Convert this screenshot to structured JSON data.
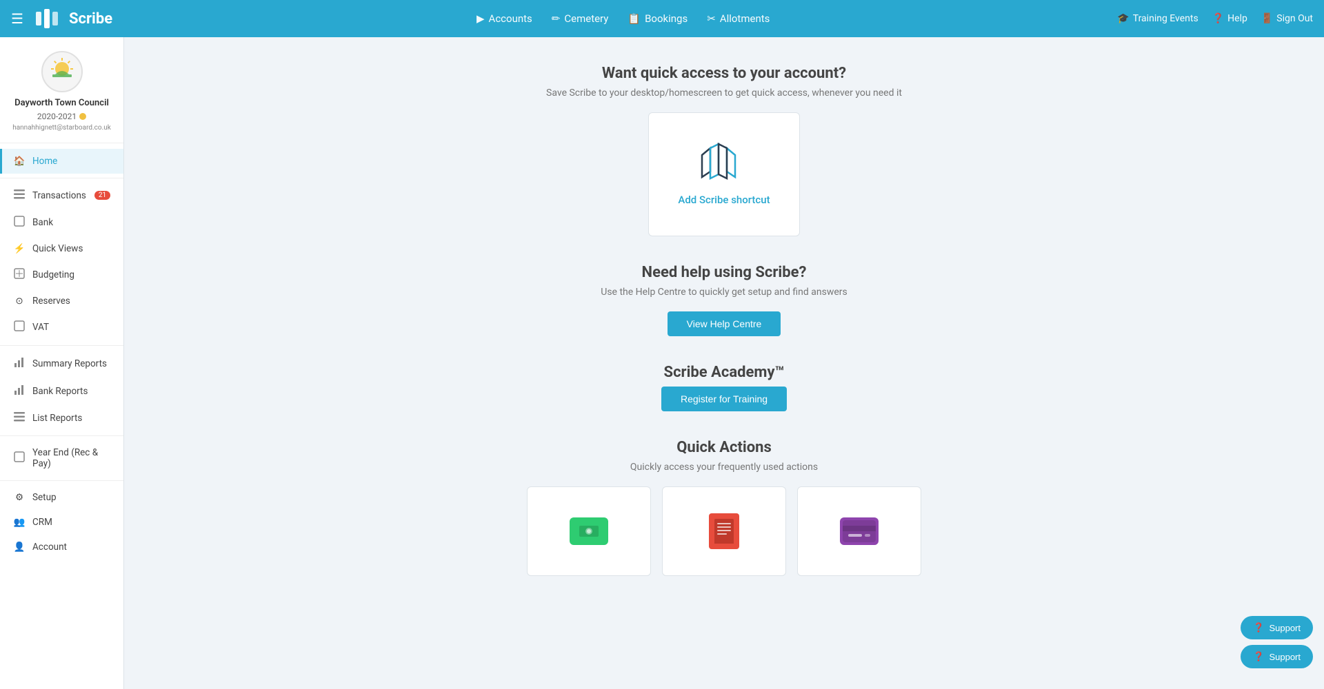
{
  "topnav": {
    "logo_text": "Scribe",
    "hamburger_label": "☰",
    "nav_links": [
      {
        "id": "accounts",
        "label": "Accounts",
        "icon": "▶"
      },
      {
        "id": "cemetery",
        "label": "Cemetery",
        "icon": "✏"
      },
      {
        "id": "bookings",
        "label": "Bookings",
        "icon": "📋"
      },
      {
        "id": "allotments",
        "label": "Allotments",
        "icon": "✂"
      }
    ],
    "right_links": [
      {
        "id": "training-events",
        "label": "Training Events",
        "icon": "🎓"
      },
      {
        "id": "help",
        "label": "Help",
        "icon": "?"
      },
      {
        "id": "sign-out",
        "label": "Sign Out",
        "icon": "→"
      }
    ]
  },
  "sidebar": {
    "org_name": "Dayworth Town Council",
    "year": "2020-2021",
    "email": "hannahhignett@starboard.co.uk",
    "items": [
      {
        "id": "home",
        "label": "Home",
        "icon": "🏠",
        "active": true
      },
      {
        "id": "transactions",
        "label": "Transactions",
        "icon": "≡",
        "badge": "21"
      },
      {
        "id": "bank",
        "label": "Bank",
        "icon": "□"
      },
      {
        "id": "quick-views",
        "label": "Quick Views",
        "icon": "⚡"
      },
      {
        "id": "budgeting",
        "label": "Budgeting",
        "icon": "□"
      },
      {
        "id": "reserves",
        "label": "Reserves",
        "icon": "⊙"
      },
      {
        "id": "vat",
        "label": "VAT",
        "icon": "□"
      },
      {
        "id": "summary-reports",
        "label": "Summary Reports",
        "icon": "📊"
      },
      {
        "id": "bank-reports",
        "label": "Bank Reports",
        "icon": "📊"
      },
      {
        "id": "list-reports",
        "label": "List Reports",
        "icon": "≡"
      },
      {
        "id": "year-end",
        "label": "Year End (Rec & Pay)",
        "icon": "□"
      },
      {
        "id": "setup",
        "label": "Setup",
        "icon": "⚙"
      },
      {
        "id": "crm",
        "label": "CRM",
        "icon": "👥"
      },
      {
        "id": "account",
        "label": "Account",
        "icon": "👤"
      }
    ]
  },
  "shortcut_section": {
    "title": "Want quick access to your account?",
    "subtitle": "Save Scribe to your desktop/homescreen to get quick access, whenever you need it",
    "card_label": "Add Scribe shortcut"
  },
  "help_section": {
    "title": "Need help using Scribe?",
    "subtitle": "Use the Help Centre to quickly get setup and find answers",
    "button_label": "View Help Centre"
  },
  "academy_section": {
    "title": "Scribe Academy™",
    "button_label": "Register for Training"
  },
  "quick_actions": {
    "title": "Quick Actions",
    "subtitle": "Quickly access your frequently used actions",
    "cards": [
      {
        "id": "money",
        "icon_type": "money"
      },
      {
        "id": "receipt",
        "icon_type": "receipt"
      },
      {
        "id": "card",
        "icon_type": "card"
      }
    ]
  },
  "support": {
    "button1_label": "Support",
    "button2_label": "Support"
  }
}
